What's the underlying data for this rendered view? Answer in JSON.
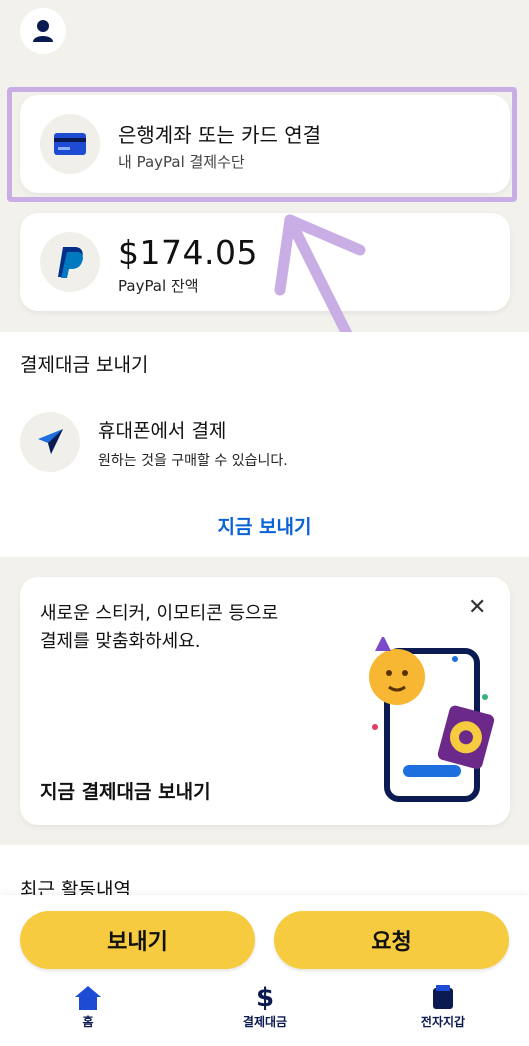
{
  "header": {
    "profile_icon": "user-icon"
  },
  "link_card": {
    "title": "은행계좌 또는 카드 연결",
    "subtitle": "내 PayPal 결제수단",
    "icon": "credit-card-icon"
  },
  "balance_card": {
    "amount": "$174.05",
    "label": "PayPal 잔액",
    "icon": "paypal-logo"
  },
  "send_section": {
    "heading": "결제대금 보내기",
    "item_title": "휴대폰에서 결제",
    "item_subtitle": "원하는 것을 구매할 수 있습니다.",
    "link": "지금 보내기"
  },
  "promo": {
    "text_line1": "새로운 스티커, 이모티콘 등으로",
    "text_line2": "결제를 맞춤화하세요.",
    "cta": "지금 결제대금 보내기"
  },
  "recent": {
    "heading": "최근 활동내역"
  },
  "actions": {
    "send": "보내기",
    "request": "요청"
  },
  "nav": {
    "items": [
      {
        "label": "홈",
        "icon": "home-icon"
      },
      {
        "label": "결제대금",
        "icon": "dollar-icon"
      },
      {
        "label": "전자지갑",
        "icon": "wallet-icon"
      }
    ]
  },
  "colors": {
    "accent_yellow": "#f7cb3f",
    "link_blue": "#0a62d6",
    "highlight": "#c9aee6",
    "navy": "#0b1a50"
  }
}
